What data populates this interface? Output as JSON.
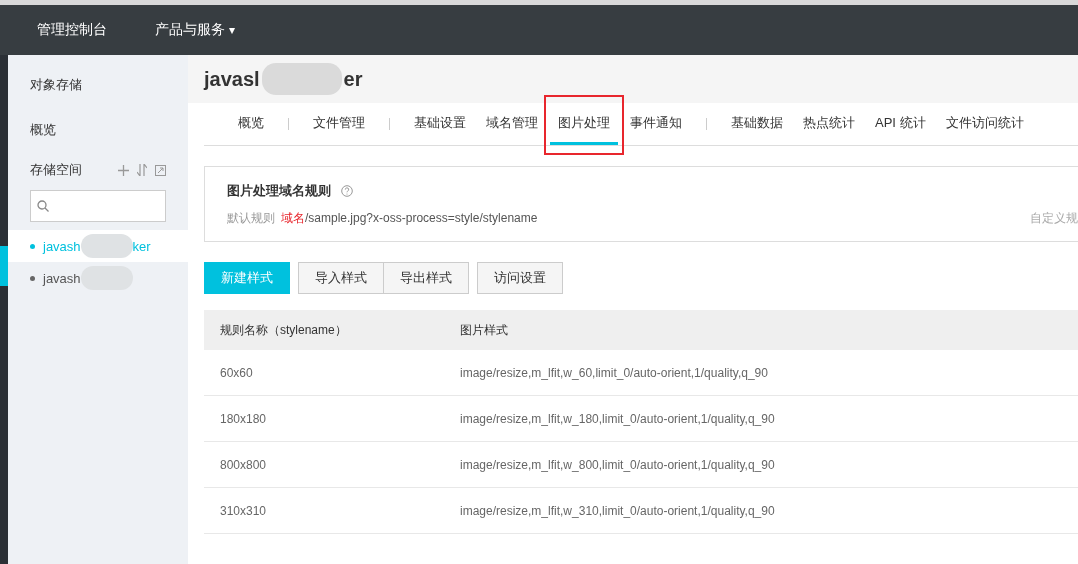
{
  "top_bar": {
    "brand": "管理控制台",
    "menu": {
      "label": "产品与服务",
      "caret": "▾"
    }
  },
  "sidebar": {
    "title": "对象存储",
    "overview": "概览",
    "section": {
      "label": "存储空间"
    },
    "buckets": [
      {
        "name_start": "javash",
        "name_end": "ker",
        "selected": true
      },
      {
        "name_start": "javash",
        "selected": false
      }
    ]
  },
  "page": {
    "title_start": "javasl",
    "title_end": "er",
    "tabs": [
      {
        "label": "概览",
        "selected": false,
        "divider_after": true
      },
      {
        "label": "文件管理",
        "selected": false,
        "divider_after": true
      },
      {
        "label": "基础设置",
        "selected": false,
        "divider_after": false
      },
      {
        "label": "域名管理",
        "selected": false,
        "divider_after": false
      },
      {
        "label": "图片处理",
        "selected": true,
        "divider_after": false,
        "highlighted": true
      },
      {
        "label": "事件通知",
        "selected": false,
        "divider_after": true
      },
      {
        "label": "基础数据",
        "selected": false,
        "divider_after": false
      },
      {
        "label": "热点统计",
        "selected": false,
        "divider_after": false
      },
      {
        "label": "API 统计",
        "selected": false,
        "divider_after": false
      },
      {
        "label": "文件访问统计",
        "selected": false,
        "divider_after": false
      }
    ],
    "rule_card": {
      "title": "图片处理域名规则",
      "rule_label": "默认规则",
      "rule_domain": "域名",
      "rule_path": "/sample.jpg?x-oss-process=style/stylename",
      "right_link": "自定义规"
    },
    "buttons": [
      {
        "label": "新建样式",
        "kind": "primary"
      },
      {
        "label": "导入样式",
        "kind": "group"
      },
      {
        "label": "导出样式",
        "kind": "group"
      },
      {
        "label": "访问设置",
        "kind": "default"
      }
    ],
    "table": {
      "columns": [
        "规则名称（stylename）",
        "图片样式"
      ],
      "rows": [
        [
          "60x60",
          "image/resize,m_lfit,w_60,limit_0/auto-orient,1/quality,q_90"
        ],
        [
          "180x180",
          "image/resize,m_lfit,w_180,limit_0/auto-orient,1/quality,q_90"
        ],
        [
          "800x800",
          "image/resize,m_lfit,w_800,limit_0/auto-orient,1/quality,q_90"
        ],
        [
          "310x310",
          "image/resize,m_lfit,w_310,limit_0/auto-orient,1/quality,q_90"
        ]
      ]
    }
  }
}
